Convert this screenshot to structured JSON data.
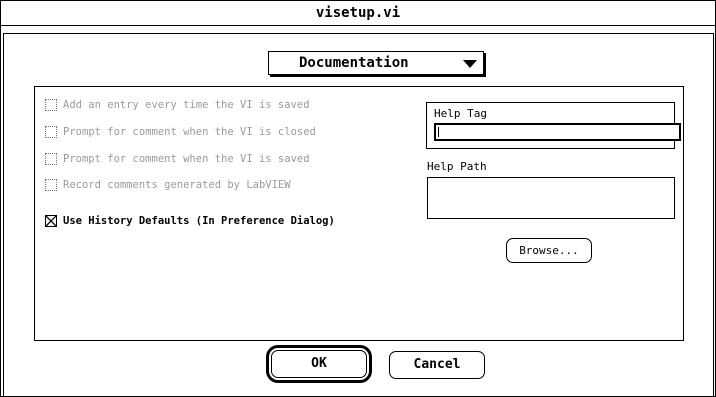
{
  "window": {
    "title": "visetup.vi"
  },
  "category_popup": {
    "selected": "Documentation"
  },
  "checkboxes": [
    {
      "label": "Add an entry every time the VI is saved",
      "checked": false,
      "enabled": false
    },
    {
      "label": "Prompt for comment when the VI is closed",
      "checked": false,
      "enabled": false
    },
    {
      "label": "Prompt for comment when the VI is saved",
      "checked": false,
      "enabled": false
    },
    {
      "label": "Record comments generated by LabVIEW",
      "checked": false,
      "enabled": false
    },
    {
      "label": "Use History Defaults (In Preference Dialog)",
      "checked": true,
      "enabled": true
    }
  ],
  "help_tag": {
    "label": "Help Tag",
    "value": ""
  },
  "help_path": {
    "label": "Help Path",
    "value": ""
  },
  "buttons": {
    "browse": "Browse...",
    "ok": "OK",
    "cancel": "Cancel"
  }
}
